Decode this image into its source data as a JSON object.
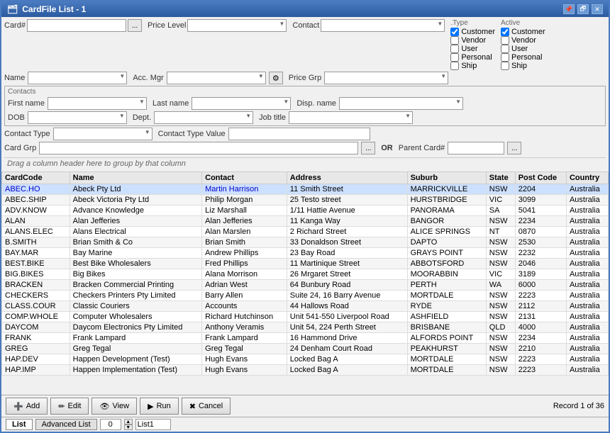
{
  "window": {
    "title": "CardFile List - 1",
    "title_icon": "📋"
  },
  "form": {
    "card_label": "Card#",
    "price_level_label": "Price Level",
    "contact_label": "Contact",
    "type_label": ".Type",
    "active_label": "Active",
    "name_label": "Name",
    "acc_mgr_label": "Acc. Mgr",
    "price_grp_label": "Price Grp",
    "contacts_label": "Contacts",
    "first_name_label": "First name",
    "last_name_label": "Last name",
    "disp_name_label": "Disp. name",
    "dob_label": "DOB",
    "dept_label": "Dept.",
    "job_title_label": "Job title",
    "contact_type_label": "Contact Type",
    "contact_type_value_label": "Contact Type Value",
    "card_grp_label": "Card Grp",
    "or_text": "OR",
    "parent_card_label": "Parent Card#"
  },
  "checkboxes": {
    "type": {
      "header": ".Type",
      "items": [
        {
          "label": "Customer",
          "checked": true
        },
        {
          "label": "Vendor",
          "checked": false
        },
        {
          "label": "User",
          "checked": false
        },
        {
          "label": "Personal",
          "checked": false
        },
        {
          "label": "Ship",
          "checked": false
        }
      ]
    },
    "active": {
      "header": "Active",
      "items": [
        {
          "label": "Customer",
          "checked": true
        },
        {
          "label": "Vendor",
          "checked": false
        },
        {
          "label": "User",
          "checked": false
        },
        {
          "label": "Personal",
          "checked": false
        },
        {
          "label": "Ship",
          "checked": false
        }
      ]
    }
  },
  "drag_hint": "Drag a column header here to group by that column",
  "table": {
    "columns": [
      "CardCode",
      "Name",
      "Contact",
      "Address",
      "Suburb",
      "State",
      "Post Code",
      "Country"
    ],
    "rows": [
      {
        "code": "ABEC.HO",
        "name": "Abeck Pty Ltd",
        "contact": "Martin Harrison",
        "address": "11 Smith Street",
        "suburb": "MARRICKVILLE",
        "state": "NSW",
        "postcode": "2204",
        "country": "Australia",
        "selected": true,
        "link": true
      },
      {
        "code": "ABEC.SHIP",
        "name": "Abeck Victoria Pty Ltd",
        "contact": "Philip Morgan",
        "address": "25 Testo street",
        "suburb": "HURSTBRIDGE",
        "state": "VIC",
        "postcode": "3099",
        "country": "Australia"
      },
      {
        "code": "ADV.KNOW",
        "name": "Advance Knowledge",
        "contact": "Liz Marshall",
        "address": "1/11 Hattie Avenue",
        "suburb": "PANORAMA",
        "state": "SA",
        "postcode": "5041",
        "country": "Australia"
      },
      {
        "code": "ALAN",
        "name": "Alan Jefferies",
        "contact": "Alan Jefferies",
        "address": "11 Kanga Way",
        "suburb": "BANGOR",
        "state": "NSW",
        "postcode": "2234",
        "country": "Australia"
      },
      {
        "code": "ALANS.ELEC",
        "name": "Alans Electrical",
        "contact": "Alan Marslen",
        "address": "2 Richard Street",
        "suburb": "ALICE SPRINGS",
        "state": "NT",
        "postcode": "0870",
        "country": "Australia"
      },
      {
        "code": "B.SMITH",
        "name": "Brian Smith & Co",
        "contact": "Brian Smith",
        "address": "33 Donaldson Street",
        "suburb": "DAPTO",
        "state": "NSW",
        "postcode": "2530",
        "country": "Australia"
      },
      {
        "code": "BAY.MAR",
        "name": "Bay Marine",
        "contact": "Andrew Phillips",
        "address": "23 Bay Road",
        "suburb": "GRAYS POINT",
        "state": "NSW",
        "postcode": "2232",
        "country": "Australia"
      },
      {
        "code": "BEST.BIKE",
        "name": "Best Bike Wholesalers",
        "contact": "Fred Phillips",
        "address": "11 Martinique Street",
        "suburb": "ABBOTSFORD",
        "state": "NSW",
        "postcode": "2046",
        "country": "Australia"
      },
      {
        "code": "BIG.BIKES",
        "name": "Big Bikes",
        "contact": "Alana Morrison",
        "address": "26 Mrgaret Street",
        "suburb": "MOORABBIN",
        "state": "VIC",
        "postcode": "3189",
        "country": "Australia"
      },
      {
        "code": "BRACKEN",
        "name": "Bracken Commercial Printing",
        "contact": "Adrian West",
        "address": "64 Bunbury Road",
        "suburb": "PERTH",
        "state": "WA",
        "postcode": "6000",
        "country": "Australia"
      },
      {
        "code": "CHECKERS",
        "name": "Checkers Printers Pty Limited",
        "contact": "Barry Allen",
        "address": "Suite 24, 16 Barry Avenue",
        "suburb": "MORTDALE",
        "state": "NSW",
        "postcode": "2223",
        "country": "Australia"
      },
      {
        "code": "CLASS.COUR",
        "name": "Classic Couriers",
        "contact": "Accounts",
        "address": "44 Hallows Road",
        "suburb": "RYDE",
        "state": "NSW",
        "postcode": "2112",
        "country": "Australia"
      },
      {
        "code": "COMP.WHOLE",
        "name": "Computer Wholesalers",
        "contact": "Richard Hutchinson",
        "address": "Unit 541-550 Liverpool Road",
        "suburb": "ASHFIELD",
        "state": "NSW",
        "postcode": "2131",
        "country": "Australia"
      },
      {
        "code": "DAYCOM",
        "name": "Daycom Electronics Pty Limited",
        "contact": "Anthony Veramis",
        "address": "Unit 54, 224 Perth Street",
        "suburb": "BRISBANE",
        "state": "QLD",
        "postcode": "4000",
        "country": "Australia"
      },
      {
        "code": "FRANK",
        "name": "Frank Lampard",
        "contact": "Frank Lampard",
        "address": "16 Hammond Drive",
        "suburb": "ALFORDS POINT",
        "state": "NSW",
        "postcode": "2234",
        "country": "Australia"
      },
      {
        "code": "GREG",
        "name": "Greg Tegal",
        "contact": "Greg Tegal",
        "address": "24 Denham Court Road",
        "suburb": "PEAKHURST",
        "state": "NSW",
        "postcode": "2210",
        "country": "Australia"
      },
      {
        "code": "HAP.DEV",
        "name": "Happen Development (Test)",
        "contact": "Hugh Evans",
        "address": "Locked Bag A",
        "suburb": "MORTDALE",
        "state": "NSW",
        "postcode": "2223",
        "country": "Australia"
      },
      {
        "code": "HAP.IMP",
        "name": "Happen Implementation (Test)",
        "contact": "Hugh Evans",
        "address": "Locked Bag A",
        "suburb": "MORTDALE",
        "state": "NSW",
        "postcode": "2223",
        "country": "Australia"
      }
    ]
  },
  "buttons": {
    "add": "Add",
    "edit": "Edit",
    "view": "View",
    "run": "Run",
    "cancel": "Cancel"
  },
  "status": {
    "list_tab": "List",
    "advanced_list_tab": "Advanced List",
    "number": "0",
    "list_name": "List1",
    "record": "Record 1 of 36"
  }
}
